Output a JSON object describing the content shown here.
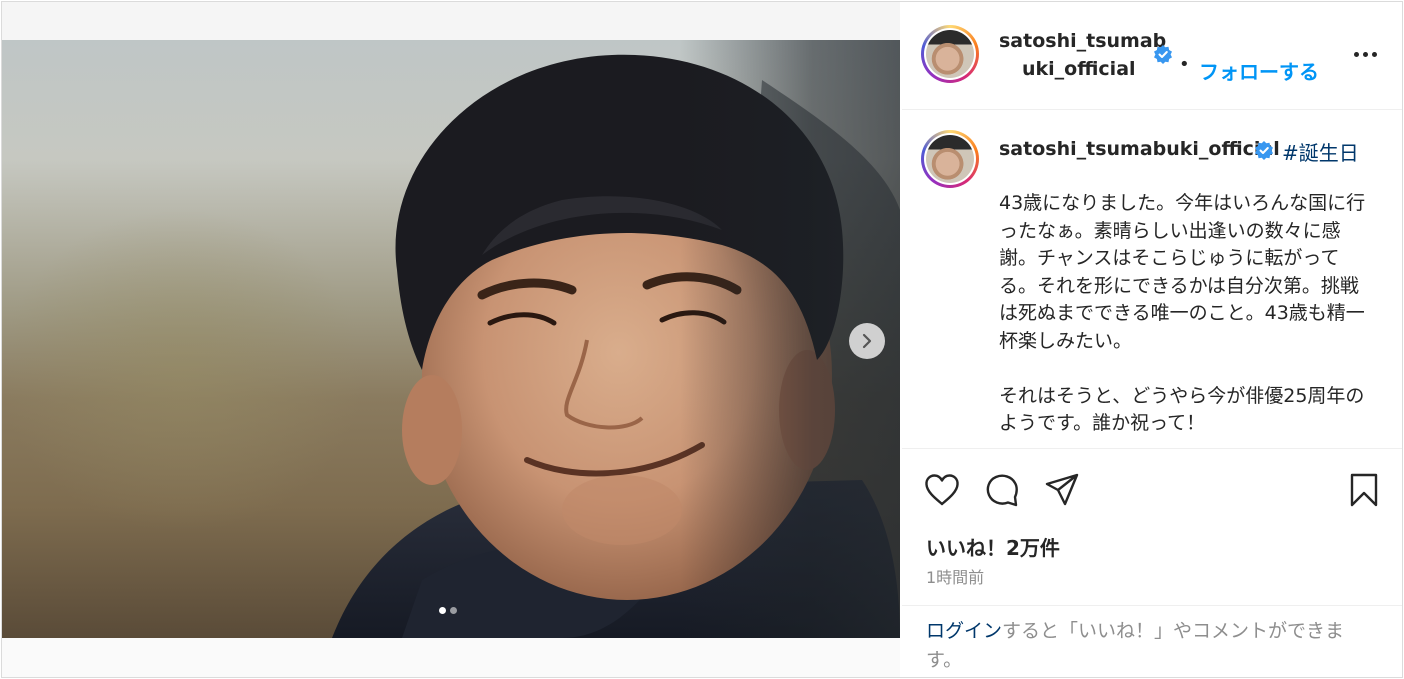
{
  "post": {
    "username_header_line1": "satoshi_tsumab",
    "username_header_line2": "uki_official",
    "separator": "•",
    "follow_label": "フォローする",
    "caption_username": "satoshi_tsumabuki_official",
    "hashtag": "#誕生日",
    "caption": "43歳になりました。今年はいろんな国に行ったなぁ。素晴らしい出逢いの数々に感謝。チャンスはそこらじゅうに転がってる。それを形にできるかは自分次第。挑戦は死ぬまでできる唯一のこと。43歳も精一杯楽しみたい。\n\nそれはそうと、どうやら今が俳優25周年のようです。誰か祝って！",
    "likes": "いいね！2万件",
    "time": "1時間前",
    "login_link": "ログイン",
    "login_rest": "すると「いいね！」やコメントができます。"
  },
  "media": {
    "image_description": "smiling man close-up photo",
    "carousel_count": 2,
    "carousel_active": 1
  },
  "colors": {
    "link_blue": "#0095f6",
    "hashtag_blue": "#00376b",
    "verified_blue": "#3897f0",
    "muted": "#8e8e8e",
    "text": "#262626"
  },
  "icons": [
    "heart-icon",
    "comment-icon",
    "share-icon",
    "bookmark-icon",
    "more-icon",
    "chevron-right-icon",
    "verified-badge-icon"
  ]
}
